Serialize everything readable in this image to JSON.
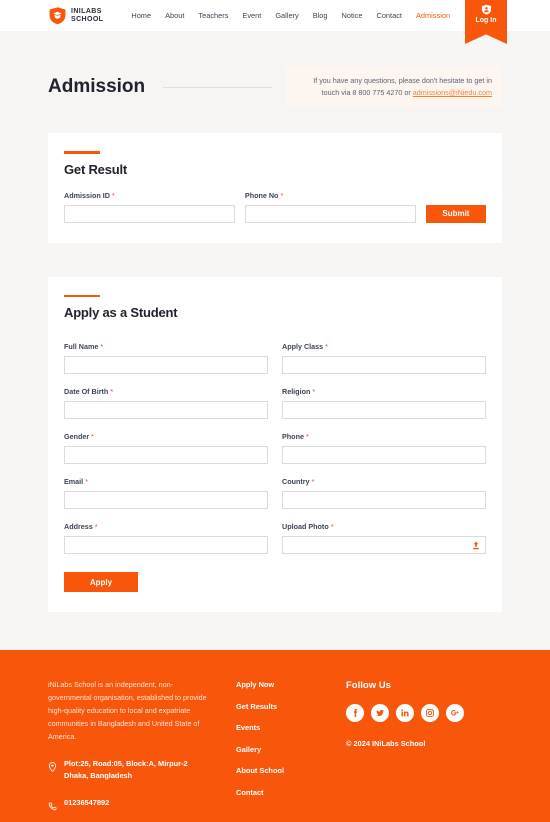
{
  "brand": {
    "name_line1": "INILABS",
    "name_line2": "SCHOOL",
    "logo_icon": "shield-graduation-cap-icon",
    "accent_color": "#f7560b"
  },
  "nav": {
    "items": [
      {
        "label": "Home",
        "active": false
      },
      {
        "label": "About",
        "active": false
      },
      {
        "label": "Teachers",
        "active": false
      },
      {
        "label": "Event",
        "active": false
      },
      {
        "label": "Gallery",
        "active": false
      },
      {
        "label": "Blog",
        "active": false
      },
      {
        "label": "Notice",
        "active": false
      },
      {
        "label": "Contact",
        "active": false
      },
      {
        "label": "Admission",
        "active": true
      }
    ],
    "login_label": "Log In",
    "login_icon": "shield-user-icon"
  },
  "page": {
    "title": "Admission",
    "contact_note_line1": "If you have any questions, please don't hesitate to get in",
    "contact_note_line2_prefix": "touch via 8 800 775 4270 or ",
    "contact_email": "admissions@iNiedu.com"
  },
  "get_result": {
    "heading": "Get Result",
    "fields": [
      {
        "label": "Admission ID",
        "required": "*",
        "value": "",
        "placeholder": ""
      },
      {
        "label": "Phone No",
        "required": "*",
        "value": "",
        "placeholder": ""
      }
    ],
    "submit_label": "Submit"
  },
  "apply": {
    "heading": "Apply as a Student",
    "fields": [
      {
        "label": "Full Name",
        "required": "*",
        "value": "",
        "placeholder": ""
      },
      {
        "label": "Apply Class",
        "required": "*",
        "value": "",
        "placeholder": ""
      },
      {
        "label": "Date Of Birth",
        "required": "*",
        "value": "",
        "placeholder": ""
      },
      {
        "label": "Religion",
        "required": "*",
        "value": "",
        "placeholder": ""
      },
      {
        "label": "Gender",
        "required": "*",
        "value": "",
        "placeholder": ""
      },
      {
        "label": "Phone",
        "required": "*",
        "value": "",
        "placeholder": ""
      },
      {
        "label": "Email",
        "required": "*",
        "value": "",
        "placeholder": ""
      },
      {
        "label": "Country",
        "required": "*",
        "value": "",
        "placeholder": ""
      },
      {
        "label": "Address",
        "required": "*",
        "value": "",
        "placeholder": ""
      },
      {
        "label": "Upload Photo",
        "required": "*",
        "value": "",
        "placeholder": "",
        "icon": "upload-icon"
      }
    ],
    "submit_label": "Apply"
  },
  "footer": {
    "about": "iNiLabs School is an independent, non-governmental organisation, established to provide high-quality education to local and expatriate communities in Bangladesh and United State of America.",
    "address_icon": "location-pin-icon",
    "address_line1": "Plot:25, Road:05, Block:A, Mirpur-2",
    "address_line2": "Dhaka, Bangladesh",
    "phone_icon": "phone-icon",
    "phone": "01236547892",
    "links": [
      {
        "label": "Apply Now"
      },
      {
        "label": "Get Results"
      },
      {
        "label": "Events"
      },
      {
        "label": "Gallery"
      },
      {
        "label": "About School"
      },
      {
        "label": "Contact"
      }
    ],
    "social_heading": "Follow Us",
    "social": [
      {
        "name": "facebook-icon"
      },
      {
        "name": "twitter-icon"
      },
      {
        "name": "linkedin-icon"
      },
      {
        "name": "instagram-icon"
      },
      {
        "name": "google-plus-icon"
      }
    ],
    "copyright": "© 2024 INiLabs School"
  }
}
